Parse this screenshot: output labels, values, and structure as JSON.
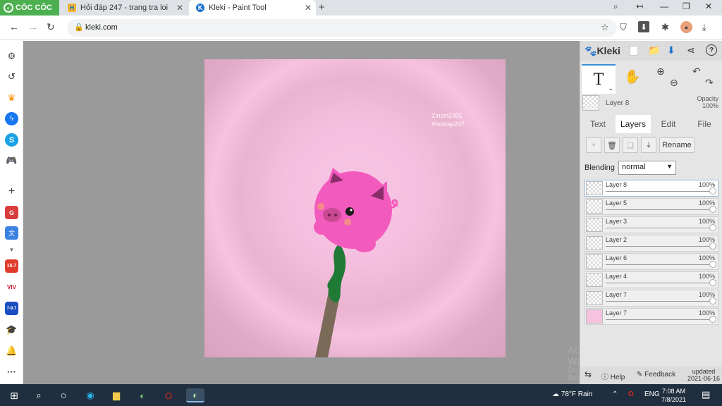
{
  "browser": {
    "brand": "CỐC CỐC",
    "tabs": [
      {
        "title": "Hỏi đáp 247 - trang tra loi",
        "favicon": "H"
      },
      {
        "title": "Kleki - Paint Tool",
        "favicon": "K"
      }
    ],
    "url": "kleki.com"
  },
  "canvas": {
    "watermark_line1": "Zinzin2301",
    "watermark_line2": "#hoidap247"
  },
  "os_overlay": {
    "activate_title": "Activate Windows",
    "activate_sub": "Go to Settings to activate Windows."
  },
  "panel": {
    "logo": "Kleki",
    "current_layer": {
      "name": "Layer 8",
      "opacity_label": "Opacity",
      "opacity_value": "100%"
    },
    "tabs": [
      "Text",
      "Layers",
      "Edit",
      "File"
    ],
    "rename_label": "Rename",
    "blending_label": "Blending",
    "blending_value": "normal",
    "layers": [
      {
        "name": "Layer 8",
        "opacity": "100%",
        "selected": true
      },
      {
        "name": "Layer 5",
        "opacity": "100%"
      },
      {
        "name": "Layer 3",
        "opacity": "100%"
      },
      {
        "name": "Layer 2",
        "opacity": "100%"
      },
      {
        "name": "Layer 6",
        "opacity": "100%"
      },
      {
        "name": "Layer 4",
        "opacity": "100%"
      },
      {
        "name": "Layer 7",
        "opacity": "100%"
      },
      {
        "name": "Layer 7",
        "opacity": "100%"
      }
    ],
    "footer": {
      "help": "Help",
      "feedback": "Feedback",
      "updated_label": "updated",
      "updated_date": "2021-06-16"
    }
  },
  "sidebar": {
    "badges": [
      "15.7",
      "7-9.7"
    ],
    "viv_label": "VIV"
  },
  "taskbar": {
    "weather": "78°F Rain",
    "lang": "ENG",
    "time": "7:08 AM",
    "date": "7/8/2021"
  },
  "colors": {
    "canvas_pink": "#f6c2e0",
    "pig_pink": "#f25bbd",
    "stem_green": "#1f7a35",
    "stick_brown": "#7a6a58",
    "accent_blue": "#3d8fd6",
    "brand_green": "#4caf50"
  }
}
